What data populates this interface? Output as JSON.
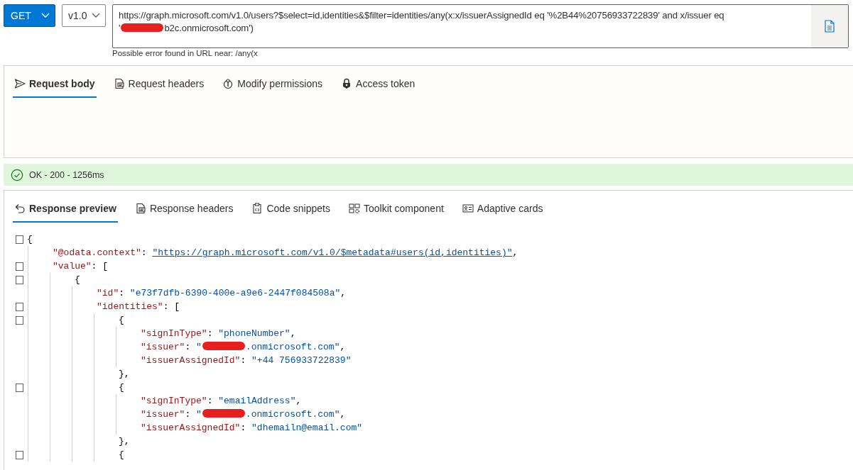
{
  "request_bar": {
    "method": "GET",
    "version": "v1.0",
    "url_lines": [
      [
        {
          "kind": "text",
          "text": "https://graph.microsoft.com/v1.0/users?$select=id,identities&$filter=identities/any(x:x/issuerAssignedId eq '%2B44%20756933722839' and x/issuer eq"
        }
      ],
      [
        {
          "kind": "text",
          "text": "'"
        },
        {
          "kind": "redaction"
        },
        {
          "kind": "text",
          "text": "b2c.onmicrosoft.com')"
        }
      ]
    ],
    "url_hint": "Possible error found in URL near: /any(x"
  },
  "request_tabs": [
    {
      "label": "Request body",
      "selected": true
    },
    {
      "label": "Request headers",
      "selected": false
    },
    {
      "label": "Modify permissions",
      "selected": false
    },
    {
      "label": "Access token",
      "selected": false
    }
  ],
  "status": {
    "kind": "success",
    "text": "OK - 200 - 1256ms"
  },
  "response_tabs": [
    {
      "label": "Response preview",
      "selected": true
    },
    {
      "label": "Response headers",
      "selected": false
    },
    {
      "label": "Code snippets",
      "selected": false
    },
    {
      "label": "Toolkit component",
      "selected": false
    },
    {
      "label": "Adaptive cards",
      "selected": false
    }
  ],
  "code": [
    {
      "foldable": true,
      "tokens": [
        {
          "kind": "punct",
          "text": "{"
        }
      ],
      "children": [
        {
          "foldable": false,
          "tokens": [
            {
              "kind": "key",
              "text": "\"@odata.context\""
            },
            {
              "kind": "punct",
              "text": ": "
            },
            {
              "kind": "link",
              "text": "\"https://graph.microsoft.com/v1.0/$metadata#users(id,identities)\""
            },
            {
              "kind": "punct",
              "text": ","
            }
          ]
        },
        {
          "foldable": true,
          "tokens": [
            {
              "kind": "key",
              "text": "\"value\""
            },
            {
              "kind": "punct",
              "text": ": ["
            }
          ],
          "children": [
            {
              "foldable": true,
              "tokens": [
                {
                  "kind": "punct",
                  "text": "{"
                }
              ],
              "children": [
                {
                  "foldable": false,
                  "tokens": [
                    {
                      "kind": "key",
                      "text": "\"id\""
                    },
                    {
                      "kind": "punct",
                      "text": ": "
                    },
                    {
                      "kind": "string",
                      "text": "\"e73f7dfb-6390-400e-a9e6-2447f084508a\""
                    },
                    {
                      "kind": "punct",
                      "text": ","
                    }
                  ]
                },
                {
                  "foldable": true,
                  "tokens": [
                    {
                      "kind": "key",
                      "text": "\"identities\""
                    },
                    {
                      "kind": "punct",
                      "text": ": ["
                    }
                  ],
                  "children": [
                    {
                      "foldable": true,
                      "tokens": [
                        {
                          "kind": "punct",
                          "text": "{"
                        }
                      ],
                      "children": [
                        {
                          "foldable": false,
                          "tokens": [
                            {
                              "kind": "key",
                              "text": "\"signInType\""
                            },
                            {
                              "kind": "punct",
                              "text": ": "
                            },
                            {
                              "kind": "string",
                              "text": "\"phoneNumber\""
                            },
                            {
                              "kind": "punct",
                              "text": ","
                            }
                          ]
                        },
                        {
                          "foldable": false,
                          "tokens": [
                            {
                              "kind": "key",
                              "text": "\"issuer\""
                            },
                            {
                              "kind": "punct",
                              "text": ": "
                            },
                            {
                              "kind": "string",
                              "text": "\""
                            },
                            {
                              "kind": "redaction"
                            },
                            {
                              "kind": "string",
                              "text": ".onmicrosoft.com\""
                            },
                            {
                              "kind": "punct",
                              "text": ","
                            }
                          ]
                        },
                        {
                          "foldable": false,
                          "tokens": [
                            {
                              "kind": "key",
                              "text": "\"issuerAssignedId\""
                            },
                            {
                              "kind": "punct",
                              "text": ": "
                            },
                            {
                              "kind": "string",
                              "text": "\"+44 756933722839\""
                            }
                          ]
                        }
                      ]
                    },
                    {
                      "foldable": false,
                      "tokens": [
                        {
                          "kind": "punct",
                          "text": "},"
                        }
                      ]
                    },
                    {
                      "foldable": true,
                      "tokens": [
                        {
                          "kind": "punct",
                          "text": "{"
                        }
                      ],
                      "children": [
                        {
                          "foldable": false,
                          "tokens": [
                            {
                              "kind": "key",
                              "text": "\"signInType\""
                            },
                            {
                              "kind": "punct",
                              "text": ": "
                            },
                            {
                              "kind": "string",
                              "text": "\"emailAddress\""
                            },
                            {
                              "kind": "punct",
                              "text": ","
                            }
                          ]
                        },
                        {
                          "foldable": false,
                          "tokens": [
                            {
                              "kind": "key",
                              "text": "\"issuer\""
                            },
                            {
                              "kind": "punct",
                              "text": ": "
                            },
                            {
                              "kind": "string",
                              "text": "\""
                            },
                            {
                              "kind": "redaction"
                            },
                            {
                              "kind": "string",
                              "text": ".onmicrosoft.com\""
                            },
                            {
                              "kind": "punct",
                              "text": ","
                            }
                          ]
                        },
                        {
                          "foldable": false,
                          "tokens": [
                            {
                              "kind": "key",
                              "text": "\"issuerAssignedId\""
                            },
                            {
                              "kind": "punct",
                              "text": ": "
                            },
                            {
                              "kind": "string",
                              "text": "\"dhemailn@email.com\""
                            }
                          ]
                        }
                      ]
                    },
                    {
                      "foldable": false,
                      "tokens": [
                        {
                          "kind": "punct",
                          "text": "},"
                        }
                      ]
                    },
                    {
                      "foldable": true,
                      "tokens": [
                        {
                          "kind": "punct",
                          "text": "{"
                        }
                      ]
                    }
                  ]
                }
              ]
            }
          ]
        }
      ]
    }
  ]
}
